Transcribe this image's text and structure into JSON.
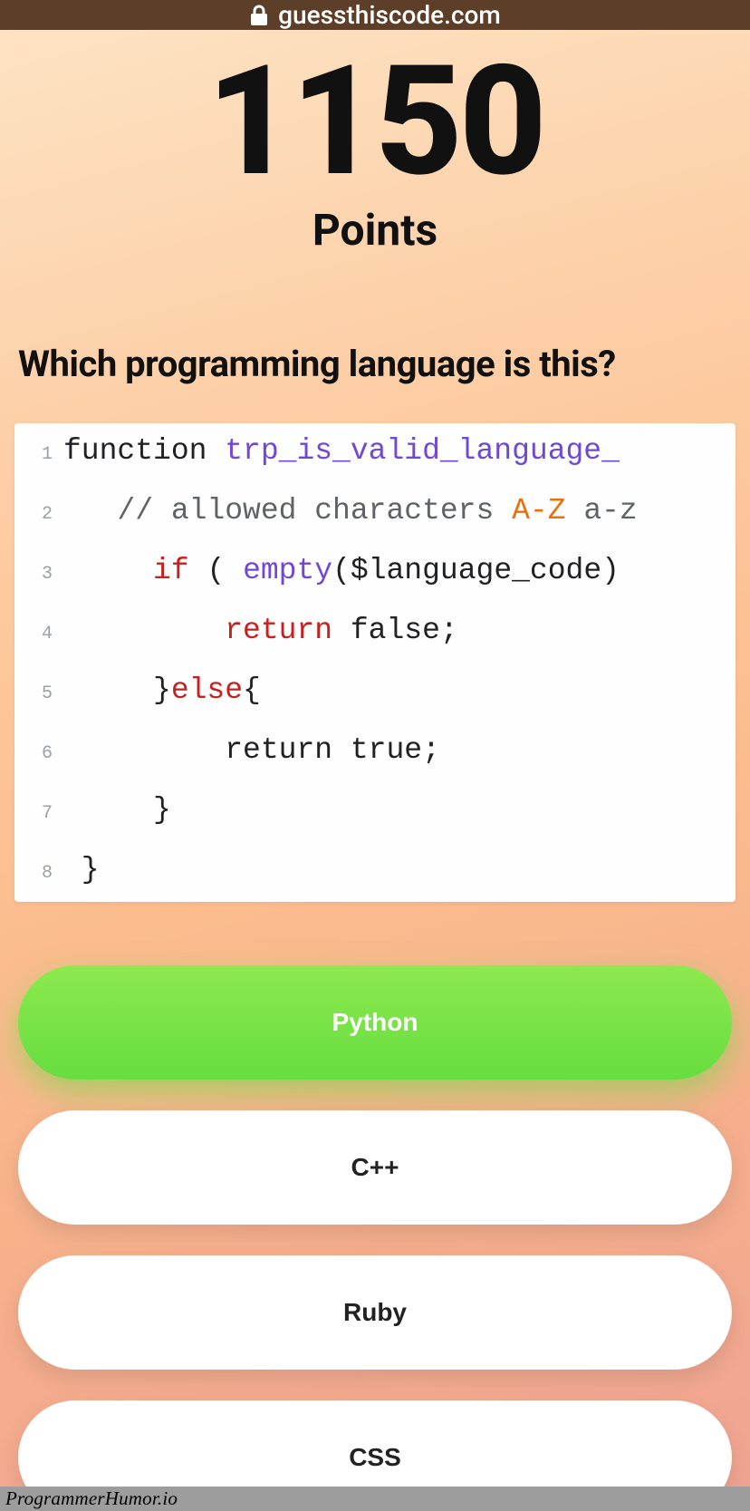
{
  "browser": {
    "domain": "guessthiscode.com"
  },
  "score": {
    "value": "1150",
    "label": "Points"
  },
  "question": "Which programming language is this?",
  "code": {
    "lines": [
      {
        "n": "1",
        "segments": [
          {
            "t": "function ",
            "c": "tok-txt"
          },
          {
            "t": "trp_is_valid_language_",
            "c": "tok-fn"
          }
        ]
      },
      {
        "n": "2",
        "segments": [
          {
            "t": "   ",
            "c": "tok-txt"
          },
          {
            "t": "// allowed characters ",
            "c": "tok-cm"
          },
          {
            "t": "A-Z",
            "c": "tok-az"
          },
          {
            "t": " a-z",
            "c": "tok-cm"
          }
        ]
      },
      {
        "n": "3",
        "segments": [
          {
            "t": "     ",
            "c": "tok-txt"
          },
          {
            "t": "if",
            "c": "tok-kw"
          },
          {
            "t": " ( ",
            "c": "tok-txt"
          },
          {
            "t": "empty",
            "c": "tok-fn"
          },
          {
            "t": "($language_code)",
            "c": "tok-txt"
          }
        ]
      },
      {
        "n": "4",
        "segments": [
          {
            "t": "         ",
            "c": "tok-txt"
          },
          {
            "t": "return",
            "c": "tok-kw"
          },
          {
            "t": " false;",
            "c": "tok-txt"
          }
        ]
      },
      {
        "n": "5",
        "segments": [
          {
            "t": "     }",
            "c": "tok-txt"
          },
          {
            "t": "else",
            "c": "tok-kw"
          },
          {
            "t": "{",
            "c": "tok-txt"
          }
        ]
      },
      {
        "n": "6",
        "segments": [
          {
            "t": "         return true;",
            "c": "tok-txt"
          }
        ]
      },
      {
        "n": "7",
        "segments": [
          {
            "t": "     }",
            "c": "tok-txt"
          }
        ]
      },
      {
        "n": "8",
        "segments": [
          {
            "t": " }",
            "c": "tok-txt"
          }
        ]
      }
    ]
  },
  "answers": [
    {
      "label": "Python",
      "selected": true
    },
    {
      "label": "C++",
      "selected": false
    },
    {
      "label": "Ruby",
      "selected": false
    },
    {
      "label": "CSS",
      "selected": false
    }
  ],
  "watermark": "ProgrammerHumor.io"
}
